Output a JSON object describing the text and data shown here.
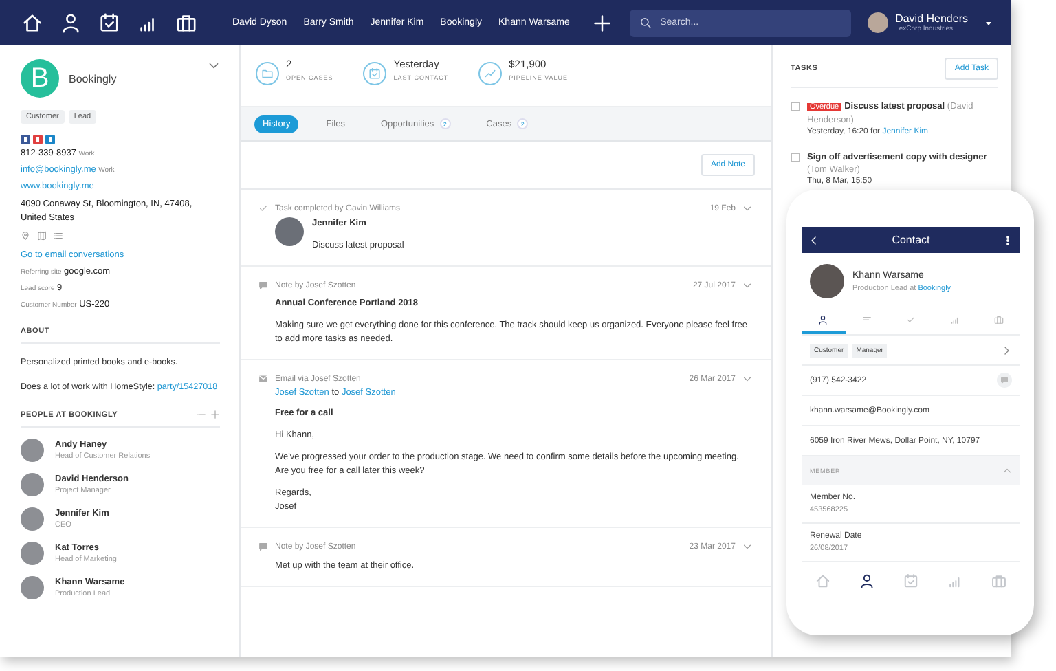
{
  "nav": {
    "links": [
      "David Dyson",
      "Barry Smith",
      "Jennifer Kim",
      "Bookingly",
      "Khann Warsame"
    ],
    "search": {
      "placeholder": "Search..."
    },
    "user": {
      "name": "David Henders",
      "company": "LexCorp Industries"
    }
  },
  "contact": {
    "initial": "B",
    "name": "Bookingly",
    "tags": [
      "Customer",
      "Lead"
    ],
    "phone": {
      "value": "812-339-8937",
      "label": "Work"
    },
    "email": {
      "value": "info@bookingly.me",
      "label": "Work"
    },
    "website": "www.bookingly.me",
    "address": "4090 Conaway St, Bloomington, IN, 47408, United States",
    "conversations_link": "Go to email conversations",
    "fields": [
      {
        "label": "Referring site",
        "value": "google.com"
      },
      {
        "label": "Lead score",
        "value": "9"
      },
      {
        "label": "Customer Number",
        "value": "US-220"
      }
    ],
    "about": {
      "heading": "ABOUT",
      "text": "Personalized printed books and e-books.",
      "note": "Does a lot of work with HomeStyle:",
      "note_link": "party/15427018"
    },
    "people": {
      "heading": "PEOPLE AT BOOKINGLY",
      "items": [
        {
          "name": "Andy Haney",
          "role": "Head of Customer Relations"
        },
        {
          "name": "David Henderson",
          "role": "Project Manager"
        },
        {
          "name": "Jennifer Kim",
          "role": "CEO"
        },
        {
          "name": "Kat Torres",
          "role": "Head of Marketing"
        },
        {
          "name": "Khann Warsame",
          "role": "Production Lead"
        }
      ]
    }
  },
  "summary": [
    {
      "kind": "cases",
      "value": "2",
      "label": "OPEN CASES"
    },
    {
      "kind": "contact",
      "value": "Yesterday",
      "label": "LAST CONTACT"
    },
    {
      "kind": "pipeline",
      "value": "$21,900",
      "label": "PIPELINE VALUE"
    }
  ],
  "tabs": [
    {
      "label": "History",
      "selected": true
    },
    {
      "label": "Files",
      "selected": false
    },
    {
      "label": "Opportunities",
      "count": "2",
      "selected": false
    },
    {
      "label": "Cases",
      "count": "2",
      "selected": false
    }
  ],
  "add_note": "Add Note",
  "feed": [
    {
      "kind": "task",
      "header": "Task completed by Gavin Williams",
      "date": "19 Feb",
      "person": "Jennifer Kim",
      "paragraphs": [
        [
          "Discuss latest proposal"
        ]
      ]
    },
    {
      "kind": "note",
      "header": "Note by Josef Szotten",
      "date": "27 Jul 2017",
      "title": "Annual Conference Portland 2018",
      "paragraphs": [
        [
          "Making sure we get everything done for this conference. The track should keep us organized. Everyone please feel free to add more tasks as needed."
        ]
      ]
    },
    {
      "kind": "email",
      "header": "Email via Josef Szotten",
      "date": "26 Mar 2017",
      "from": "Josef Szotten",
      "to_word": "to",
      "to": "Josef Szotten",
      "title": "Free for a call",
      "paragraphs": [
        [
          "Hi Khann,"
        ],
        [
          "We've progressed your order to the production stage. We need to confirm some details before the upcoming meeting.",
          "Are you free for a call later this week?"
        ],
        [
          "Regards,",
          "Josef"
        ]
      ]
    },
    {
      "kind": "note",
      "header": "Note by Josef Szotten",
      "date": "23 Mar 2017",
      "paragraphs": [
        [
          "Met up with the team at their office."
        ]
      ]
    }
  ],
  "tasks": {
    "heading": "TASKS",
    "add_button": "Add Task",
    "items": [
      {
        "checked": false,
        "badge": "Overdue",
        "title": "Discuss latest proposal",
        "assignee": "(David Henderson)",
        "due": "Yesterday, 16:20",
        "connector": "for",
        "owner": "Jennifer Kim"
      },
      {
        "checked": false,
        "title": "Sign off advertisement copy with designer",
        "assignee": "(Tom Walker)",
        "due": "Thu, 8 Mar, 15:50"
      }
    ]
  },
  "phone": {
    "title": "Contact",
    "name": "Khann Warsame",
    "role": "Production Lead at",
    "company": "Bookingly",
    "tabs": [
      {
        "selected": true
      },
      {
        "selected": false
      },
      {
        "selected": false
      },
      {
        "selected": false
      },
      {
        "selected": false
      }
    ],
    "tags": [
      "Customer",
      "Manager"
    ],
    "rows": [
      {
        "kind": "phone",
        "text": "(917) 542-3422"
      },
      {
        "kind": "email",
        "text": "khann.warsame@Bookingly.com"
      },
      {
        "kind": "address",
        "text": "6059 Iron River Mews, Dollar Point, NY, 10797"
      }
    ],
    "section": "MEMBER",
    "fields": [
      {
        "label": "Member No.",
        "value": "453568225"
      },
      {
        "label": "Renewal Date",
        "value": "26/08/2017"
      }
    ],
    "bottom_nav": [
      {
        "selected": false
      },
      {
        "selected": true
      },
      {
        "selected": false
      },
      {
        "selected": false
      },
      {
        "selected": false
      }
    ]
  }
}
